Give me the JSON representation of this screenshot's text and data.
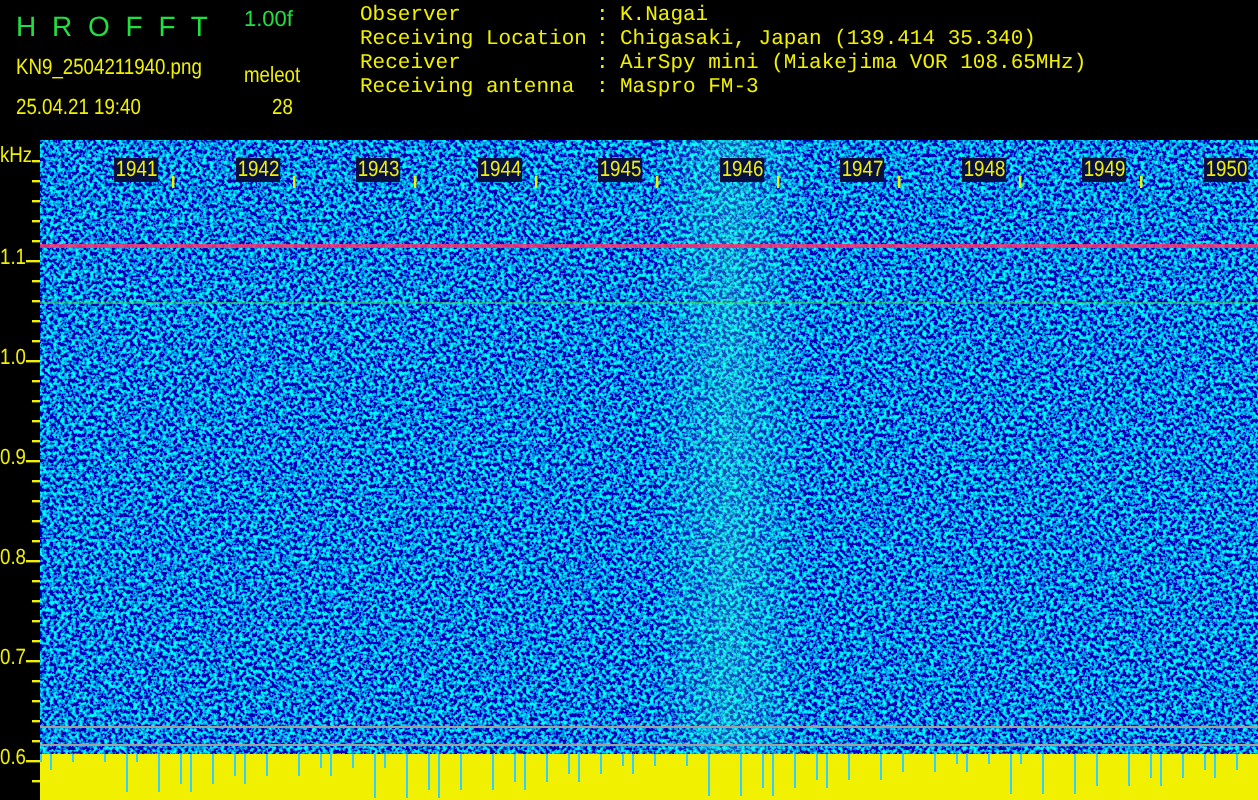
{
  "header": {
    "title": "H R O F F T",
    "version": "1.00f",
    "filename": "KN9_2504211940.png",
    "mode": "meleot",
    "timestamp": "25.04.21 19:40",
    "count": "28"
  },
  "info": [
    {
      "label": "Observer",
      "separator": ":",
      "value": "K.Nagai"
    },
    {
      "label": "Receiving Location",
      "separator": ":",
      "value": "Chigasaki, Japan (139.414 35.340)"
    },
    {
      "label": "Receiver",
      "separator": ":",
      "value": "AirSpy mini (Miakejima VOR 108.65MHz)"
    },
    {
      "label": "Receiving antenna",
      "separator": ":",
      "value": "Maspro FM-3"
    }
  ],
  "spectrogram": {
    "unit": "kHz",
    "x_labels": [
      "1941",
      "1942",
      "1943",
      "1944",
      "1945",
      "1946",
      "1947",
      "1948",
      "1949",
      "1950"
    ],
    "y_labels": [
      "1.1",
      "1.0",
      "0.9",
      "0.8",
      "0.7",
      "0.6"
    ]
  }
}
